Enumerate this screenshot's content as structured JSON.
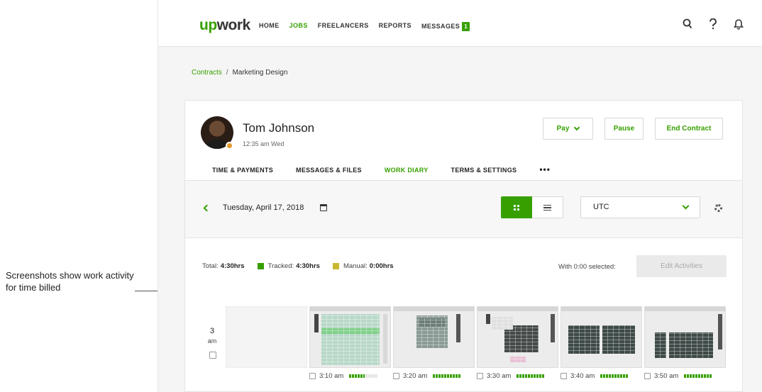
{
  "callout": {
    "text": "Screenshots show work activity for time billed"
  },
  "topbar": {
    "logo_up": "up",
    "logo_rest": "work",
    "nav": [
      {
        "label": "HOME",
        "active": false
      },
      {
        "label": "JOBS",
        "active": true
      },
      {
        "label": "FREELANCERS",
        "active": false
      },
      {
        "label": "REPORTS",
        "active": false
      },
      {
        "label": "MESSAGES",
        "active": false
      }
    ],
    "messages_badge": "1",
    "icons": [
      "search-icon",
      "help-icon",
      "bell-icon"
    ]
  },
  "breadcrumb": {
    "parent": "Contracts",
    "separator": "/",
    "current": "Marketing Design"
  },
  "contract": {
    "name": "Tom Johnson",
    "local_time": "12:35 am Wed",
    "buttons": {
      "pay": "Pay",
      "pause": "Pause",
      "end": "End Contract"
    },
    "tabs": [
      {
        "label": "TIME & PAYMENTS",
        "active": false
      },
      {
        "label": "MESSAGES & FILES",
        "active": false
      },
      {
        "label": "WORK DIARY",
        "active": true
      },
      {
        "label": "TERMS & SETTINGS",
        "active": false
      }
    ],
    "more_label": "•••"
  },
  "diary": {
    "date": "Tuesday, April 17, 2018",
    "timezone": "UTC",
    "totals": {
      "total_label": "Total:",
      "total_value": "4:30hrs",
      "tracked_label": "Tracked:",
      "tracked_value": "4:30hrs",
      "manual_label": "Manual:",
      "manual_value": "0:00hrs"
    },
    "selected_text": "With 0:00 selected:",
    "edit_label": "Edit Activities",
    "hour": {
      "label": "3",
      "period": "am"
    },
    "slots": [
      {
        "time": "3:10 am",
        "activity": 0.55
      },
      {
        "time": "3:20 am",
        "activity": 1.0
      },
      {
        "time": "3:30 am",
        "activity": 0.9
      },
      {
        "time": "3:40 am",
        "activity": 1.0
      },
      {
        "time": "3:50 am",
        "activity": 1.0
      }
    ]
  },
  "colors": {
    "brand": "#37a000",
    "status": "#e29a2c",
    "manual": "#c8b830"
  }
}
